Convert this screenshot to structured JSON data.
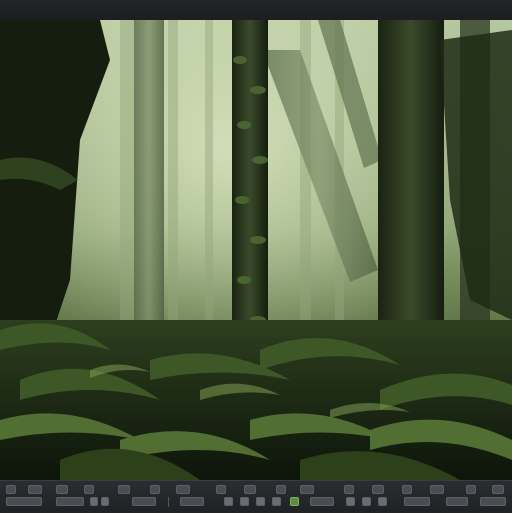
{
  "window": {
    "canvas_image": "rainforest-jungle-scene",
    "toolbar_icons": [
      "tool-icon"
    ]
  }
}
